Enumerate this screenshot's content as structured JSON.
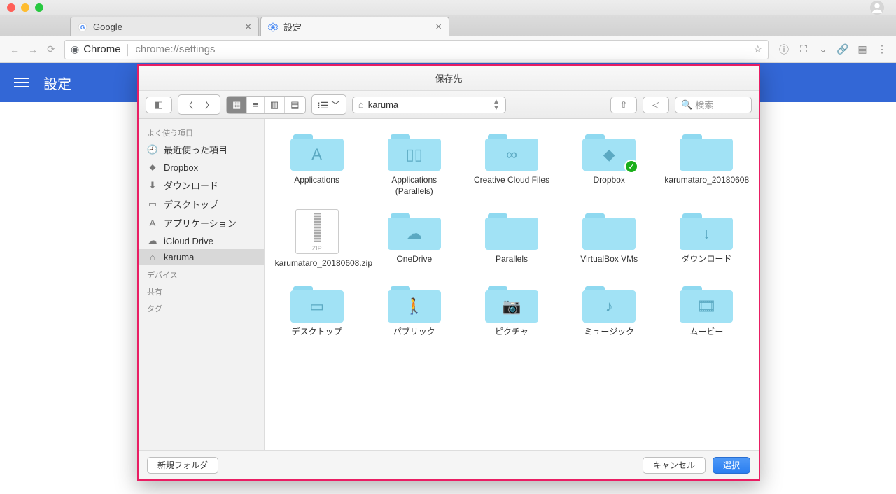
{
  "tabs": [
    {
      "label": "Google",
      "favicon": "google"
    },
    {
      "label": "設定",
      "favicon": "gear"
    }
  ],
  "omnibox": {
    "chip": "Chrome",
    "url": "chrome://settings"
  },
  "header": {
    "title": "設定"
  },
  "dialog": {
    "title": "保存先",
    "path_label": "karuma",
    "search_placeholder": "検索",
    "new_folder": "新規フォルダ",
    "cancel": "キャンセル",
    "select": "選択"
  },
  "sidebar": {
    "favorites_header": "よく使う項目",
    "devices_header": "デバイス",
    "shared_header": "共有",
    "tags_header": "タグ",
    "items": [
      {
        "label": "最近使った項目",
        "icon": "clock"
      },
      {
        "label": "Dropbox",
        "icon": "dropbox"
      },
      {
        "label": "ダウンロード",
        "icon": "download"
      },
      {
        "label": "デスクトップ",
        "icon": "desktop"
      },
      {
        "label": "アプリケーション",
        "icon": "apps"
      },
      {
        "label": "iCloud Drive",
        "icon": "cloud"
      },
      {
        "label": "karuma",
        "icon": "home",
        "selected": true
      }
    ]
  },
  "files": [
    {
      "label": "Applications",
      "type": "folder",
      "glyph": "A"
    },
    {
      "label": "Applications (Parallels)",
      "type": "folder",
      "glyph": "▯▯"
    },
    {
      "label": "Creative Cloud Files",
      "type": "folder",
      "glyph": "∞"
    },
    {
      "label": "Dropbox",
      "type": "folder",
      "glyph": "◆",
      "badge": "check"
    },
    {
      "label": "karumataro_20180608",
      "type": "folder",
      "glyph": ""
    },
    {
      "label": "karumataro_20180608.zip",
      "type": "zip",
      "glyph": "ZIP"
    },
    {
      "label": "OneDrive",
      "type": "folder",
      "glyph": "☁"
    },
    {
      "label": "Parallels",
      "type": "folder",
      "glyph": ""
    },
    {
      "label": "VirtualBox VMs",
      "type": "folder",
      "glyph": ""
    },
    {
      "label": "ダウンロード",
      "type": "folder",
      "glyph": "↓"
    },
    {
      "label": "デスクトップ",
      "type": "folder",
      "glyph": "▭"
    },
    {
      "label": "パブリック",
      "type": "folder",
      "glyph": "🚶"
    },
    {
      "label": "ピクチャ",
      "type": "folder",
      "glyph": "📷"
    },
    {
      "label": "ミュージック",
      "type": "folder",
      "glyph": "♪"
    },
    {
      "label": "ムービー",
      "type": "folder",
      "glyph": "🎞"
    }
  ]
}
